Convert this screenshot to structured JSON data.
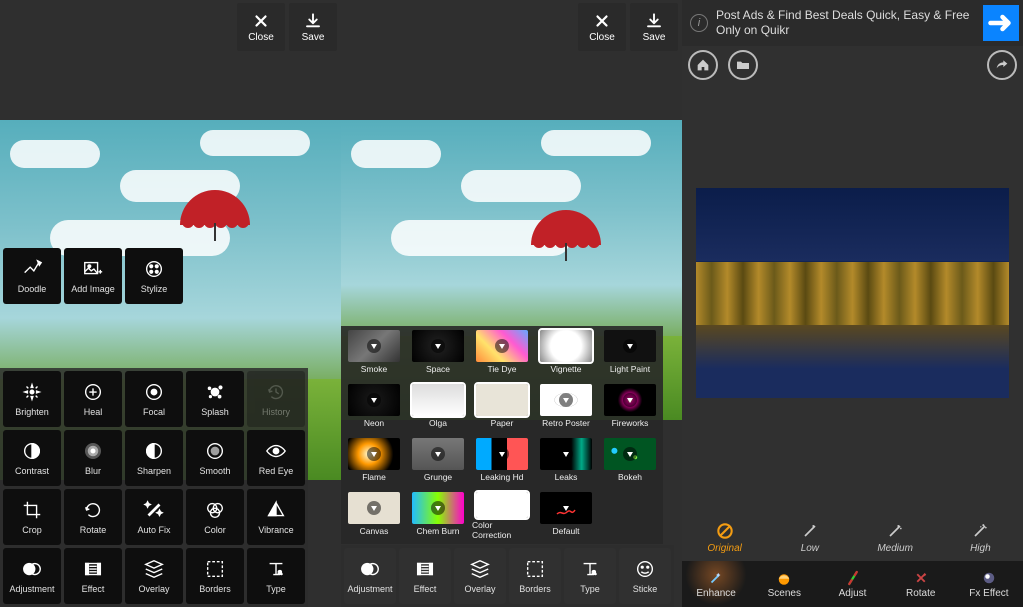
{
  "toolbar": {
    "close": "Close",
    "save": "Save"
  },
  "screen1": {
    "row_top": [
      {
        "id": "doodle",
        "label": "Doodle"
      },
      {
        "id": "add-image",
        "label": "Add Image"
      },
      {
        "id": "stylize",
        "label": "Stylize"
      }
    ],
    "grid": [
      {
        "id": "brighten",
        "label": "Brighten"
      },
      {
        "id": "heal",
        "label": "Heal"
      },
      {
        "id": "focal",
        "label": "Focal"
      },
      {
        "id": "splash",
        "label": "Splash"
      },
      {
        "id": "history",
        "label": "History",
        "dim": true
      },
      {
        "id": "contrast",
        "label": "Contrast"
      },
      {
        "id": "blur",
        "label": "Blur"
      },
      {
        "id": "sharpen",
        "label": "Sharpen"
      },
      {
        "id": "smooth",
        "label": "Smooth"
      },
      {
        "id": "redeye",
        "label": "Red Eye"
      },
      {
        "id": "crop",
        "label": "Crop"
      },
      {
        "id": "rotate",
        "label": "Rotate"
      },
      {
        "id": "autofix",
        "label": "Auto Fix"
      },
      {
        "id": "color",
        "label": "Color"
      },
      {
        "id": "vibrance",
        "label": "Vibrance"
      },
      {
        "id": "adjustment",
        "label": "Adjustment"
      },
      {
        "id": "effect",
        "label": "Effect"
      },
      {
        "id": "overlay",
        "label": "Overlay"
      },
      {
        "id": "borders",
        "label": "Borders"
      },
      {
        "id": "type",
        "label": "Type"
      }
    ]
  },
  "screen2": {
    "fx_top": [
      {
        "id": "smoke",
        "label": "Smoke",
        "bg": "linear-gradient(135deg,#444,#777,#333)"
      },
      {
        "id": "space",
        "label": "Space",
        "bg": "radial-gradient(circle,#222 0%,#000 100%)"
      },
      {
        "id": "tiedye",
        "label": "Tie Dye",
        "bg": "linear-gradient(45deg,#ff8c3b,#ffe26b,#ff5bd1,#63aaff)"
      },
      {
        "id": "vignette",
        "label": "Vignette",
        "bg": "radial-gradient(circle,#fff 20%,#fff 50%,#888 100%)",
        "sel": true
      },
      {
        "id": "lightpaint",
        "label": "Light Paint",
        "bg": "#111"
      },
      {
        "id": "neon",
        "label": "Neon",
        "bg": "radial-gradient(circle,#1a1a1a,#000)"
      },
      {
        "id": "olga",
        "label": "Olga",
        "bg": "linear-gradient(#ddd,#fff)",
        "sel": true
      },
      {
        "id": "paper",
        "label": "Paper",
        "bg": "#e8e4d8",
        "sel": true
      },
      {
        "id": "retroposter",
        "label": "Retro Poster",
        "bg": "radial-gradient(#fff 0,#fff 30%,#bbb 31%,#fff 32%)"
      },
      {
        "id": "fireworks",
        "label": "Fireworks",
        "bg": "radial-gradient(circle,#ff5,#f0a 10%,#000 40%)"
      },
      {
        "id": "flame",
        "label": "Flame",
        "bg": "radial-gradient(circle at 40% 50%,#ffd 0,#f90 30%,#000 70%)"
      },
      {
        "id": "grunge",
        "label": "Grunge",
        "bg": "linear-gradient(#777,#555)"
      },
      {
        "id": "leakinghd",
        "label": "Leaking Hd",
        "bg": "linear-gradient(90deg,#0af 0,#0af 30%,#000 30%,#000 60%,#f55 60%)"
      },
      {
        "id": "leaks",
        "label": "Leaks",
        "bg": "linear-gradient(90deg,#000 0,#000 60%,#0a8 80%,#000 100%)"
      },
      {
        "id": "bokeh",
        "label": "Bokeh",
        "bg": "radial-gradient(circle at 20% 40%,#2cf 0,#2cf 6%,transparent 7%),radial-gradient(circle at 60% 60%,#8f4 0,#8f4 5%,transparent 6%),#052"
      },
      {
        "id": "canvas",
        "label": "Canvas",
        "bg": "#e6e0d2"
      },
      {
        "id": "chemburn",
        "label": "Chem Burn",
        "bg": "linear-gradient(90deg,#2bf,#8f0,#f0c)"
      },
      {
        "id": "colorcorrection",
        "label": "Color Correction",
        "bg": "#fff",
        "sel": true
      },
      {
        "id": "default",
        "label": "Default",
        "bg": "#000",
        "swirl": true
      }
    ],
    "bottom_row": [
      {
        "id": "adjustment",
        "label": "Adjustment"
      },
      {
        "id": "effect",
        "label": "Effect"
      },
      {
        "id": "overlay",
        "label": "Overlay"
      },
      {
        "id": "borders",
        "label": "Borders"
      },
      {
        "id": "type",
        "label": "Type"
      },
      {
        "id": "sticker",
        "label": "Sticke"
      }
    ]
  },
  "screen3": {
    "ad_text": "Post Ads & Find Best Deals Quick, Easy & Free Only on Quikr",
    "strength": [
      {
        "id": "original",
        "label": "Original",
        "active": true
      },
      {
        "id": "low",
        "label": "Low"
      },
      {
        "id": "medium",
        "label": "Medium"
      },
      {
        "id": "high",
        "label": "High"
      }
    ],
    "tabs": [
      {
        "id": "enhance",
        "label": "Enhance",
        "active": true
      },
      {
        "id": "scenes",
        "label": "Scenes"
      },
      {
        "id": "adjust",
        "label": "Adjust"
      },
      {
        "id": "rotate",
        "label": "Rotate"
      },
      {
        "id": "fxeffect",
        "label": "Fx Effect"
      }
    ]
  }
}
